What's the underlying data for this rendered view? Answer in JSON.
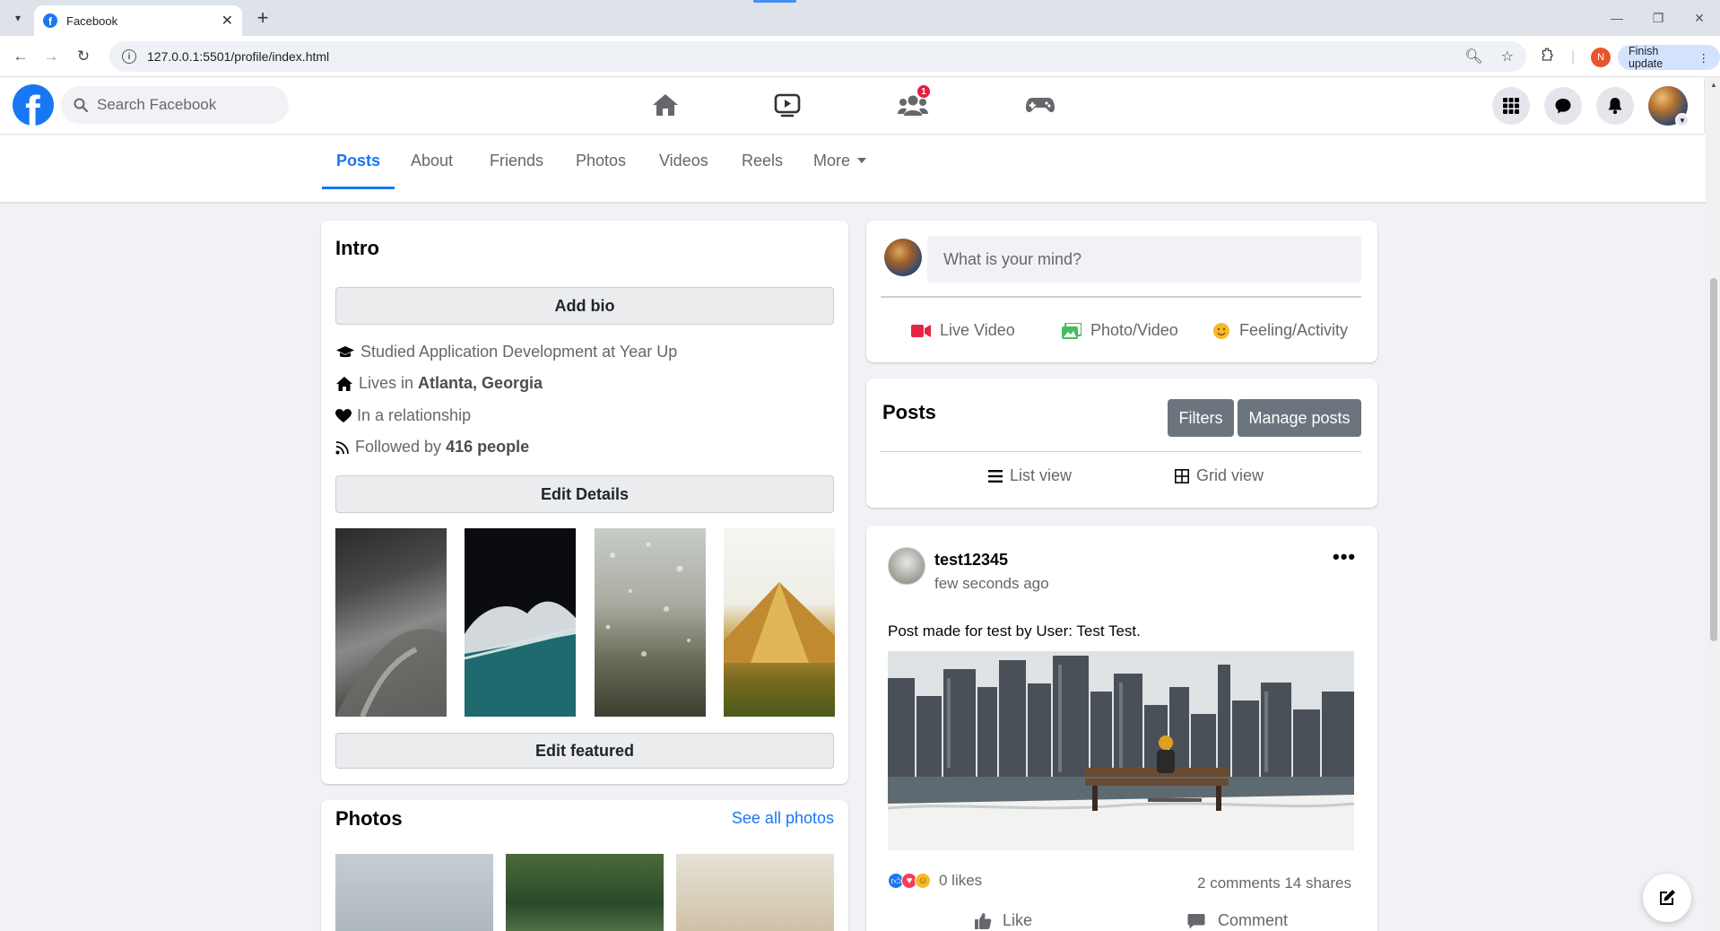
{
  "browser": {
    "tab_title": "Facebook",
    "url": "127.0.0.1:5501/profile/index.html",
    "profile_initial": "N",
    "update_label": "Finish update"
  },
  "topnav": {
    "search_placeholder": "Search Facebook",
    "groups_badge": "1"
  },
  "profile_tabs": [
    "Posts",
    "About",
    "Friends",
    "Photos",
    "Videos",
    "Reels",
    "More"
  ],
  "intro": {
    "title": "Intro",
    "add_bio": "Add bio",
    "education_prefix": "Studied Application Development at Year Up",
    "lives_prefix": "Lives in ",
    "lives_place": "Atlanta, Georgia",
    "relationship": "In a relationship",
    "followed_prefix": "Followed by ",
    "followed_count": "416 people",
    "edit_details": "Edit Details",
    "edit_featured": "Edit featured"
  },
  "photos": {
    "title": "Photos",
    "see_all": "See all photos"
  },
  "composer": {
    "placeholder": "What is your mind?",
    "live_video": "Live Video",
    "photo_video": "Photo/Video",
    "feeling": "Feeling/Activity"
  },
  "posts_panel": {
    "title": "Posts",
    "filters": "Filters",
    "manage": "Manage posts",
    "list_view": "List view",
    "grid_view": "Grid view"
  },
  "post": {
    "author": "test12345",
    "time": "few seconds ago",
    "text": "Post made for test by User: Test Test.",
    "likes": "0 likes",
    "comments_shares": "2 comments 14 shares",
    "like_label": "Like",
    "comment_label": "Comment"
  },
  "colors": {
    "brand": "#1877f2",
    "live_red": "#e42645",
    "photo_green": "#45bd62",
    "feeling_yellow": "#f7b928"
  }
}
